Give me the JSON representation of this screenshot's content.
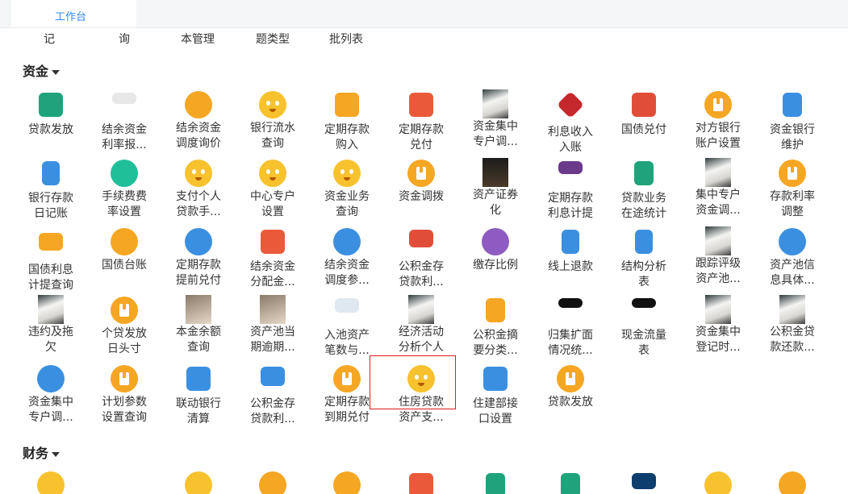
{
  "tab": {
    "label": "工作台"
  },
  "top_row_partial": [
    "记",
    "询",
    "本管理",
    "题类型",
    "批列表"
  ],
  "sections": {
    "funds": "资金",
    "finance": "财务"
  },
  "items": [
    "贷款发放",
    "结余资金\n利率报...",
    "结余资金\n调度询价",
    "银行流水\n查询",
    "定期存款\n购入",
    "定期存款\n兑付",
    "资金集中\n专户调...",
    "利息收入\n入账",
    "国债兑付",
    "对方银行\n账户设置",
    "资金银行\n维护",
    "银行存款\n日记账",
    "手续费费\n率设置",
    "支付个人\n贷款手...",
    "中心专户\n设置",
    "资金业务\n查询",
    "资金调拨",
    "资产证券\n化",
    "定期存款\n利息计提",
    "贷款业务\n在途统计",
    "集中专户\n资金调...",
    "存款利率\n调整",
    "国债利息\n计提查询",
    "国债台账",
    "定期存款\n提前兑付",
    "结余资金\n分配金...",
    "结余资金\n调度参...",
    "公积金存\n贷款利...",
    "缴存比例",
    "线上退款",
    "结构分析\n表",
    "跟踪评级\n资产池...",
    "资产池信\n息具体...",
    "违约及拖\n欠",
    "个贷发放\n日头寸",
    "本金余额\n查询",
    "资产池当\n期逾期...",
    "入池资产\n笔数与...",
    "经济活动\n分析个人",
    "公积金摘\n要分类...",
    "归集扩面\n情况统...",
    "现金流量\n表",
    "资金集中\n登记时...",
    "公积金贷\n款还款...",
    "资金集中\n专户调...",
    "计划参数\n设置查询",
    "联动银行\n清算",
    "公积金存\n贷款利...",
    "定期存款\n到期兑付",
    "住房贷款\n资产支...",
    "住建部接\n口设置",
    "贷款发放"
  ],
  "icons": [
    "money-hand-icon",
    "thumbnail-image-icon",
    "transfer-arrows-icon",
    "emoji-face-icon",
    "plant-icon",
    "cancel-document-icon",
    "photo-thumbnail-icon",
    "diamond-badge-icon",
    "yen-check-icon",
    "document-circle-icon",
    "document-edit-icon"
  ]
}
